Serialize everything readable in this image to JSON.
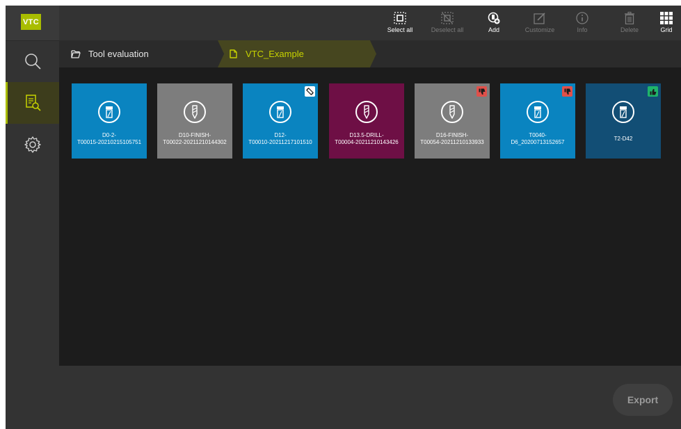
{
  "app": {
    "logo_text": "VTC"
  },
  "sidebar": {
    "items": [
      {
        "name": "search",
        "icon": "search-icon"
      },
      {
        "name": "tool-evaluation",
        "icon": "report-search-icon",
        "active": true
      },
      {
        "name": "settings",
        "icon": "gear-icon"
      }
    ]
  },
  "toolbar": {
    "select_all": "Select all",
    "deselect_all": "Deselect all",
    "add": "Add",
    "customize": "Customize",
    "info": "Info",
    "delete": "Delete",
    "grid": "Grid"
  },
  "breadcrumb": {
    "root": "Tool evaluation",
    "current": "VTC_Example"
  },
  "tiles": [
    {
      "line1": "D0-2-",
      "line2": "T00015-20210215105751",
      "color": "#0a84c0",
      "icon": "mill-tool-icon",
      "badge": null
    },
    {
      "line1": "D10-FINISH-",
      "line2": "T00022-20211210144302",
      "color": "#7d7d7d",
      "icon": "drill-tool-icon",
      "badge": null
    },
    {
      "line1": "D12-",
      "line2": "T00010-20211217101510",
      "color": "#0a84c0",
      "icon": "mill-tool-icon",
      "badge": "ruler-icon"
    },
    {
      "line1": "D13.5-DRILL-",
      "line2": "T00004-20211210143426",
      "color": "#6e0f45",
      "icon": "drill-tool-icon",
      "badge": null
    },
    {
      "line1": "D16-FINISH-",
      "line2": "T00054-20211210133933",
      "color": "#7d7d7d",
      "icon": "drill-tool-icon",
      "badge": "thumbs-down-icon"
    },
    {
      "line1": "T0040-",
      "line2": "D6_20200713152657",
      "color": "#0a84c0",
      "icon": "mill-tool-icon",
      "badge": "thumbs-down-icon"
    },
    {
      "line1": "T2-D42",
      "line2": "",
      "color": "#124e75",
      "icon": "mill-tool-icon",
      "badge": "thumbs-up-icon"
    }
  ],
  "colors": {
    "accent": "#a9bd00",
    "thumbs_down": "#e0504a",
    "thumbs_up": "#1fb36a"
  },
  "footer": {
    "export_label": "Export"
  }
}
